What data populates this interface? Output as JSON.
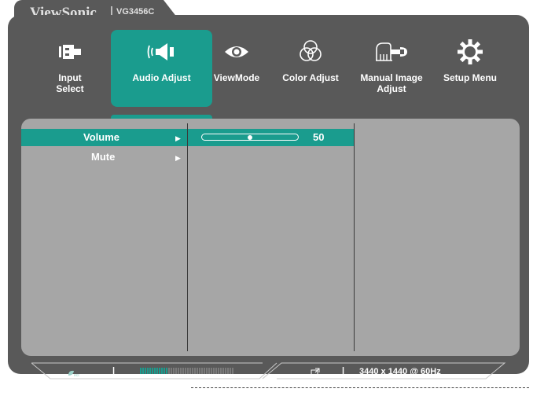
{
  "brand": {
    "name": "ViewSonic",
    "model": "VG3456C"
  },
  "menu": {
    "items": [
      {
        "label": "Input\nSelect",
        "line1": "Input",
        "line2": "Select",
        "icon": "input-icon",
        "active": false
      },
      {
        "label": "Audio Adjust",
        "line1": "Audio Adjust",
        "line2": "",
        "icon": "speaker-icon",
        "active": true
      },
      {
        "label": "ViewMode",
        "line1": "ViewMode",
        "line2": "",
        "icon": "eye-icon",
        "active": false
      },
      {
        "label": "Color Adjust",
        "line1": "Color Adjust",
        "line2": "",
        "icon": "color-circles-icon",
        "active": false
      },
      {
        "label": "Manual Image Adjust",
        "line1": "Manual Image",
        "line2": "Adjust",
        "icon": "hand-wrench-icon",
        "active": false
      },
      {
        "label": "Setup Menu",
        "line1": "Setup Menu",
        "line2": "",
        "icon": "gear-icon",
        "active": false
      }
    ]
  },
  "submenu": {
    "items": [
      {
        "label": "Volume",
        "selected": true
      },
      {
        "label": "Mute",
        "selected": false
      }
    ]
  },
  "volume": {
    "value": "50",
    "fraction": 0.5
  },
  "status": {
    "eco_icon": "eco-leaf-icon",
    "signal_icon": "external-link-icon",
    "resolution": "3440 x 1440 @ 60Hz",
    "level_fraction": 0.3
  },
  "colors": {
    "accent": "#1a9c8e",
    "frame": "#595959",
    "panel": "#a6a6a6"
  }
}
